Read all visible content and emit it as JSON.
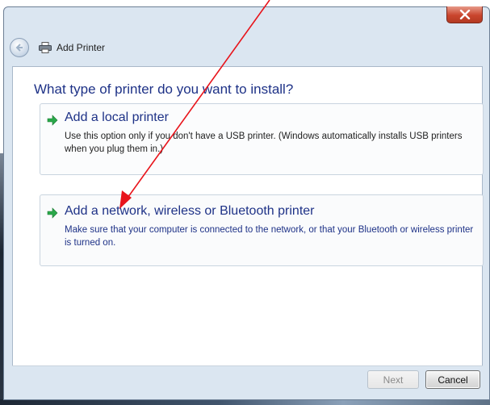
{
  "window": {
    "title": "Add Printer",
    "close_label": "X"
  },
  "main": {
    "question": "What type of printer do you want to install?",
    "options": [
      {
        "title": "Add a local printer",
        "description": "Use this option only if you don't have a USB printer. (Windows automatically installs USB printers when you plug them in.)",
        "icon": "green-arrow-icon"
      },
      {
        "title": "Add a network, wireless or Bluetooth printer",
        "description": "Make sure that your computer is connected to the network, or that your Bluetooth or wireless printer is turned on.",
        "icon": "green-arrow-icon"
      }
    ]
  },
  "footer": {
    "next_label": "Next",
    "cancel_label": "Cancel"
  },
  "colors": {
    "heading_blue": "#1e3287",
    "annotation_red": "#e8141b",
    "arrow_green": "#2aa84a"
  }
}
